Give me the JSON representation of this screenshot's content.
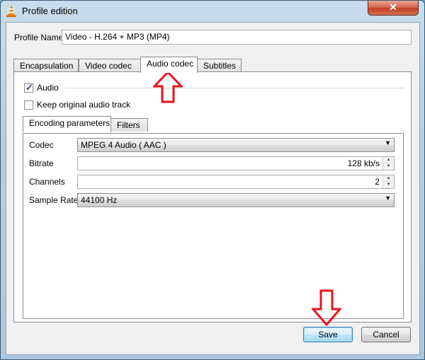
{
  "window": {
    "title": "Profile edition",
    "close_label": "✕"
  },
  "profile": {
    "label": "Profile Name",
    "value": "Video - H.264 + MP3 (MP4)"
  },
  "tabs": [
    {
      "label": "Encapsulation"
    },
    {
      "label": "Video codec"
    },
    {
      "label": "Audio codec"
    },
    {
      "label": "Subtitles"
    }
  ],
  "audio": {
    "audio_checkbox_label": "Audio",
    "audio_checked": true,
    "keep_original_label": "Keep original audio track",
    "keep_original_checked": false
  },
  "inner_tabs": [
    {
      "label": "Encoding parameters"
    },
    {
      "label": "Filters"
    }
  ],
  "encoding": {
    "codec_label": "Codec",
    "codec_value": "MPEG 4 Audio ( AAC )",
    "bitrate_label": "Bitrate",
    "bitrate_value": "128 kb/s",
    "channels_label": "Channels",
    "channels_value": "2",
    "sample_rate_label": "Sample Rate",
    "sample_rate_value": "44100 Hz"
  },
  "buttons": {
    "save": "Save",
    "cancel": "Cancel"
  },
  "colors": {
    "annotation_arrow": "#e8141e",
    "accent": "#3c7fb1"
  }
}
